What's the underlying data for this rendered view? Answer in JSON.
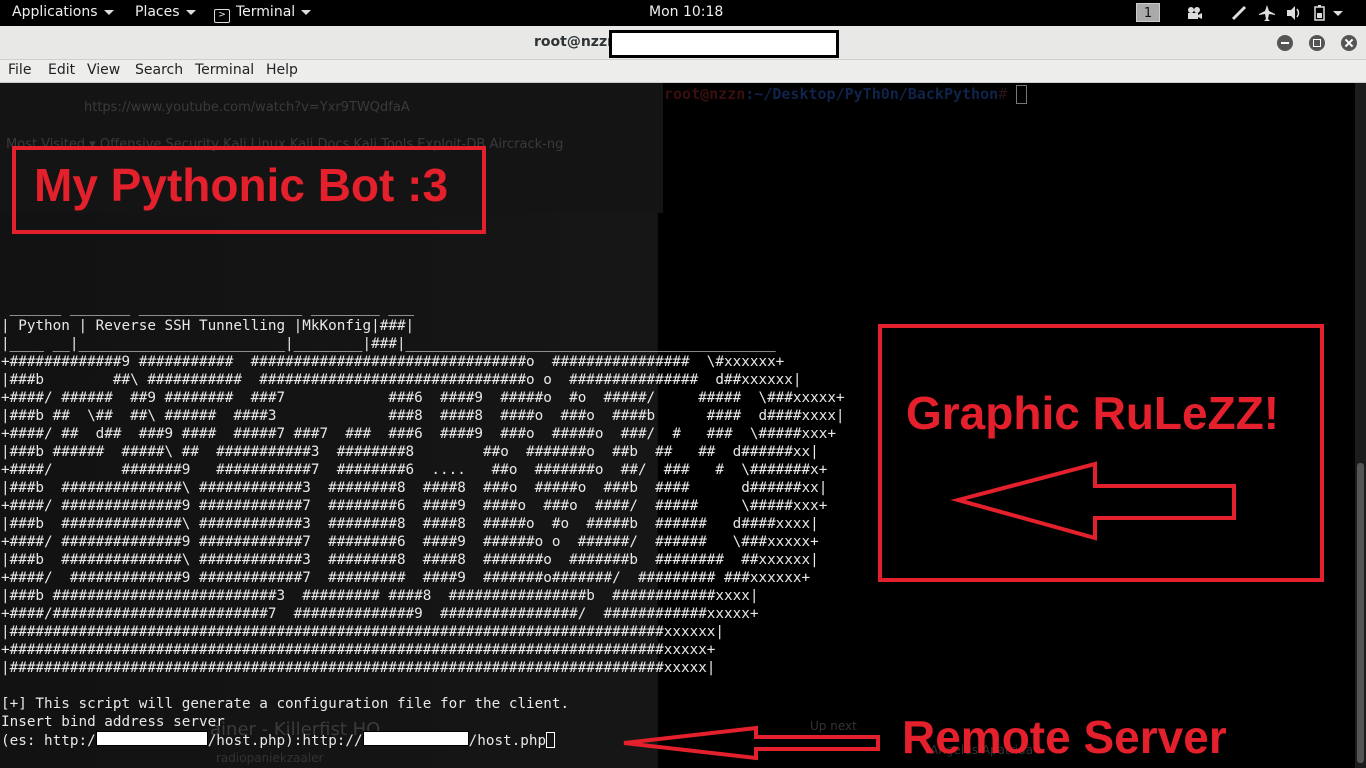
{
  "topbar": {
    "applications": "Applications",
    "places": "Places",
    "terminal_app": "Terminal",
    "clock": "Mon 10:18",
    "workspace": "1",
    "tray_icons": [
      "camera-icon",
      "pen-icon",
      "airplane-mode-icon",
      "volume-icon",
      "battery-icon",
      "power-menu-icon"
    ]
  },
  "window": {
    "title": "root@nzzn"
  },
  "menu": {
    "items": [
      "File",
      "Edit",
      "View",
      "Search",
      "Terminal",
      "Help"
    ]
  },
  "background": {
    "url": "https://www.youtube.com/watch?v=Yxr9TWQdfaA",
    "bookmarks": "Most Visited ▾   Offensive Security   Kali Linux   Kali Docs   Kali Tools   Exploit-DB   Aircrack-ng",
    "song_title": "ainer - Killerfist HQ",
    "channel": "radiopaniekzaaler",
    "up_next": "Up next",
    "side_title": "Angelus Apatrida"
  },
  "terminal": {
    "prompt_user": "root@nzzn",
    "prompt_path": ":~/Desktop/PyTh0n/BackPython",
    "prompt_symbol": "# ",
    "ascii_art": " ______ _______ ___________________ ________ ___\n| Python | Reverse SSH Tunnelling |MkKonfig|###|\n|____ __|________________________|________|###|___________________________________________\n+#############9 ###########  ################################o  ################  \\#xxxxxx+\n|###b        ##\\ ###########  ###############################o o  ###############  d##xxxxxx|\n+####/ ######  ##9 ########  ###7            ###6  ####9  #####o  #o  #####/     #####  \\###xxxxx+\n|###b ##  \\##  ##\\ ######  ####3             ###8  ####8  ####o  ###o  ####b      ####  d####xxxx|\n+####/ ##  d##  ###9 ####  #####7 ###7  ###  ###6  ####9  ###o  #####o  ###/  #   ###  \\#####xxx+\n|###b ######  #####\\ ##  ###########3  ########8        ##o  #######o  ##b  ##   ##  d######xx|\n+####/        #######9   ###########7  ########6  ....   ##o  #######o  ##/  ###   #  \\#######x+\n|###b  ##############\\ ############3  ########8  ####8  ###o  #####o  ###b  ####      d######xx|\n+####/ ##############9 ############7  ########6  ####9  ####o  ###o  ####/  #####     \\#####xxx+\n|###b  ##############\\ ############3  ########8  ####8  #####o  #o  #####b  ######   d####xxxx|\n+####/ ##############9 ############7  ########6  ####9  ######o o  ######/  ######   \\###xxxxx+\n|###b  ##############\\ ############3  ########8  ####8  #######o  #######b  ########  ##xxxxxx|\n+####/  #############9 ############7  #########  ####9  #######o#######/  ######### ###xxxxxx+\n|###b ##########################3  ######### ####8  ################b  ############xxxx|\n+####/#########################7  ##############9  ################/  ############xxxxx+\n|############################################################################xxxxxx|\n+############################################################################xxxxx+\n|############################################################################xxxxx|",
    "line1": "[+] This script will generate a configuration file for the client.",
    "line2": "Insert bind address server",
    "line3_prefix": "(es: http:/",
    "line3_mid": "/host.php):http://",
    "line3_suffix": "/host.php"
  },
  "annotations": {
    "bot_label": "My Pythonic Bot :3",
    "graphic_label": "Graphic RuLeZZ!",
    "remote_label": "Remote Server",
    "color": "#e3202b"
  }
}
